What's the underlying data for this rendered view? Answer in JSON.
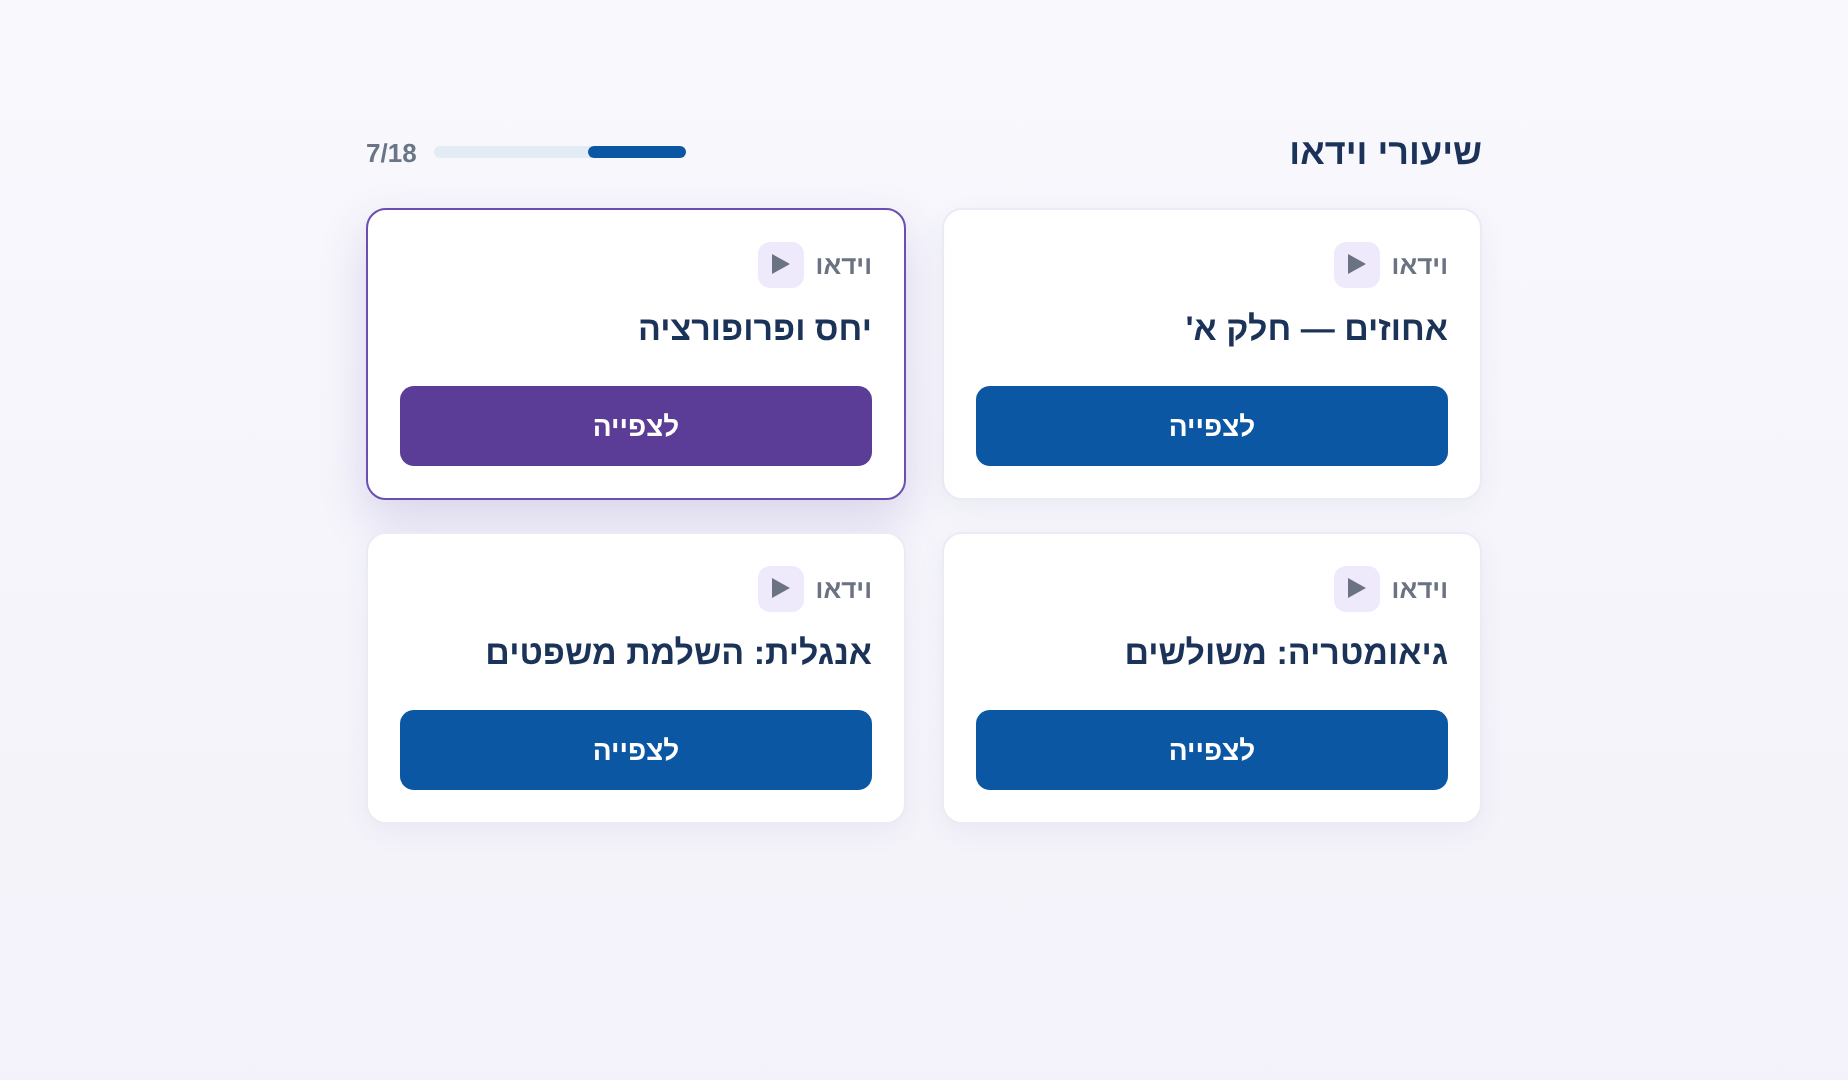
{
  "header": {
    "title": "שיעורי וידאו",
    "progress": {
      "label": "7/18",
      "level": 0.389
    }
  },
  "cards": [
    {
      "type_label": "וידאו",
      "title": "אחוזים — חלק א'",
      "button": "לצפייה",
      "selected": false
    },
    {
      "type_label": "וידאו",
      "title": "יחס ופרופורציה",
      "button": "לצפייה",
      "selected": true
    },
    {
      "type_label": "וידאו",
      "title": "גיאומטריה: משולשים",
      "button": "לצפייה",
      "selected": false
    },
    {
      "type_label": "וידאו",
      "title": "אנגלית: השלמת משפטים",
      "button": "לצפייה",
      "selected": false
    }
  ]
}
